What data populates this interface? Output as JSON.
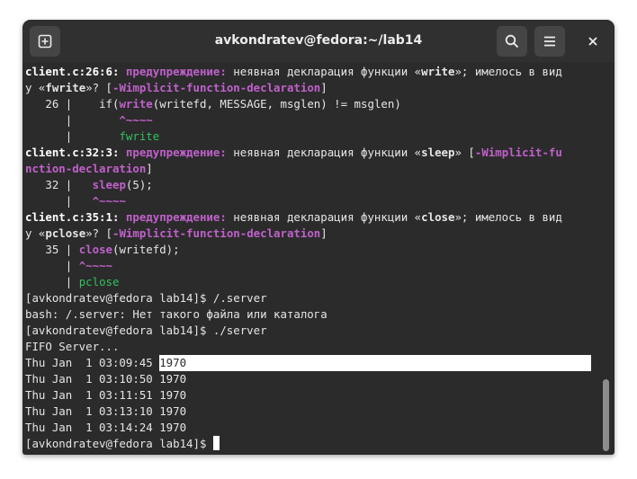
{
  "window": {
    "title": "avkondratev@fedora:~/lab14"
  },
  "toolbar": {
    "new_tab_icon": "new-tab-icon",
    "search_icon": "search-icon",
    "menu_icon": "hamburger-menu-icon",
    "close_icon": "close-icon"
  },
  "terminal": {
    "l1": {
      "loc": "client.c:26:6:",
      "warn": "предупреждение:",
      "t1": " неявная декларация функции «",
      "fn": "write",
      "t2": "»; имелось в вид"
    },
    "l2": {
      "t1": "у «",
      "fn": "fwrite",
      "t2": "»? [",
      "flag": "-Wimplicit-function-declaration",
      "t3": "]"
    },
    "l3": {
      "gutter": "   26 |   ",
      "t1": " if(",
      "fn": "write",
      "t2": "(writefd, MESSAGE, msglen) != msglen)"
    },
    "l4": {
      "gutter": "      |       ",
      "mark": "^~~~~"
    },
    "l5": {
      "gutter": "      |       ",
      "fix": "fwrite"
    },
    "l6": {
      "loc": "client.c:32:3:",
      "warn": "предупреждение:",
      "t1": " неявная декларация функции «",
      "fn": "sleep",
      "t2": "» [",
      "flag": "-Wimplicit-fu"
    },
    "l7": {
      "flag": "nction-declaration",
      "t1": "]"
    },
    "l8": {
      "gutter": "   32 |   ",
      "fn": "sleep",
      "t1": "(5);"
    },
    "l9": {
      "gutter": "      |   ",
      "mark": "^~~~~"
    },
    "l10": {
      "loc": "client.c:35:1:",
      "warn": "предупреждение:",
      "t1": " неявная декларация функции «",
      "fn": "close",
      "t2": "»; имелось в вид"
    },
    "l11": {
      "t1": "у «",
      "fn": "pclose",
      "t2": "»? [",
      "flag": "-Wimplicit-function-declaration",
      "t3": "]"
    },
    "l12": {
      "gutter": "   35 | ",
      "fn": "close",
      "t1": "(writefd);"
    },
    "l13": {
      "gutter": "      | ",
      "mark": "^~~~~"
    },
    "l14": {
      "gutter": "      | ",
      "fix": "pclose"
    },
    "l15": "[avkondratev@fedora lab14]$ /.server",
    "l16": "bash: /.server: Нет такого файла или каталога",
    "l17": "[avkondratev@fedora lab14]$ ./server",
    "l18": "FIFO Server...",
    "l19": {
      "t1": "Thu Jan  1 03:09:45 ",
      "hl": "1970"
    },
    "l20": "Thu Jan  1 03:10:50 1970",
    "l21": "Thu Jan  1 03:11:51 1970",
    "l22": "Thu Jan  1 03:13:10 1970",
    "l23": "Thu Jan  1 03:14:24 1970",
    "l24": "[avkondratev@fedora lab14]$ "
  }
}
